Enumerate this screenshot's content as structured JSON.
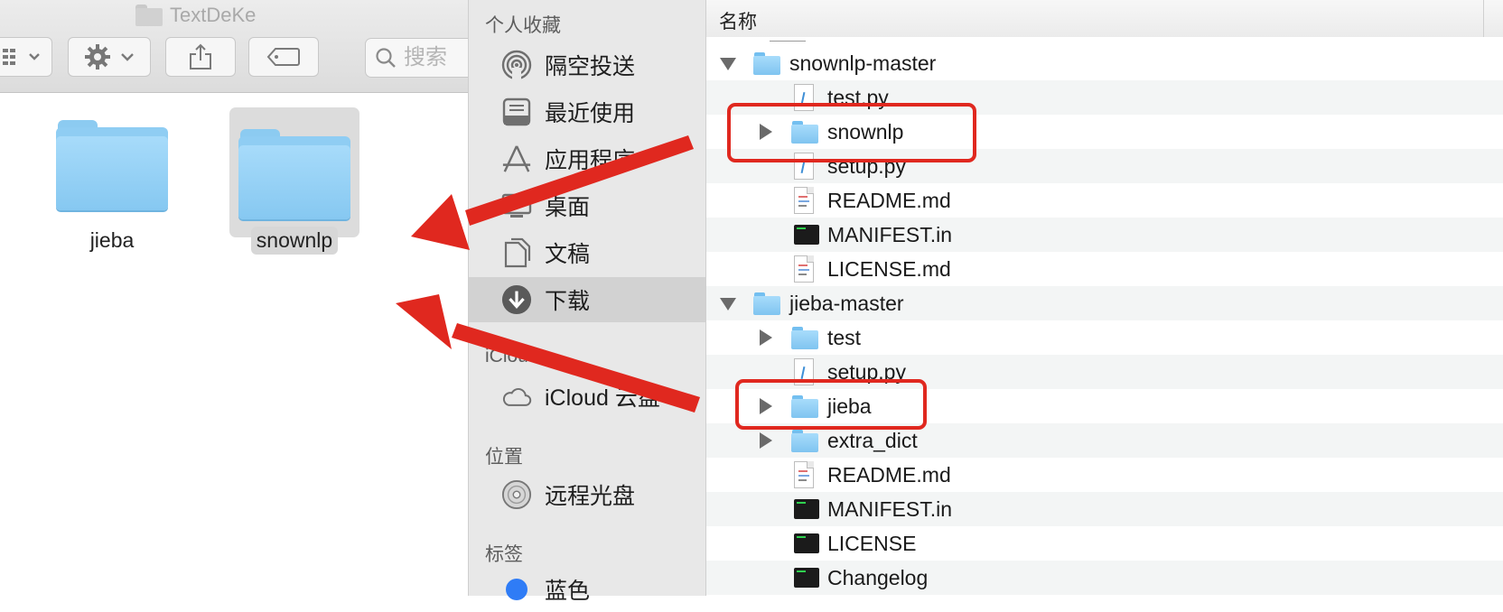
{
  "window": {
    "title": "TextDeKe"
  },
  "toolbar": {
    "search_placeholder": "搜索",
    "view_icon": "grid-view-icon",
    "gear_icon": "gear-icon",
    "share_icon": "share-icon",
    "tag_icon": "tag-icon"
  },
  "icon_view": {
    "items": [
      {
        "label": "jieba",
        "icon": "folder-icon"
      },
      {
        "label": "snownlp",
        "icon": "folder-icon",
        "selected": true
      }
    ]
  },
  "sidebar": {
    "favorites_header": "个人收藏",
    "favorites": [
      {
        "label": "隔空投送",
        "icon": "airdrop-icon"
      },
      {
        "label": "最近使用",
        "icon": "recents-icon"
      },
      {
        "label": "应用程序",
        "icon": "applications-icon"
      },
      {
        "label": "桌面",
        "icon": "desktop-icon"
      },
      {
        "label": "文稿",
        "icon": "documents-icon"
      },
      {
        "label": "下载",
        "icon": "downloads-icon",
        "selected": true
      }
    ],
    "icloud_header": "iCloud",
    "icloud": [
      {
        "label": "iCloud 云盘",
        "icon": "icloud-icon"
      }
    ],
    "locations_header": "位置",
    "locations": [
      {
        "label": "远程光盘",
        "icon": "remote-disc-icon"
      }
    ],
    "tags_header": "标签",
    "tags": [
      {
        "label": "蓝色",
        "color": "#2f7cf6"
      }
    ]
  },
  "list_view": {
    "column_name": "名称",
    "rows": [
      {
        "name": "snownlp-master",
        "kind": "folder",
        "level": 0,
        "expanded": true
      },
      {
        "name": "test.py",
        "kind": "python",
        "level": 1
      },
      {
        "name": "snownlp",
        "kind": "folder",
        "level": 1,
        "expanded": false,
        "highlighted": true
      },
      {
        "name": "setup.py",
        "kind": "python",
        "level": 1
      },
      {
        "name": "README.md",
        "kind": "document",
        "level": 1
      },
      {
        "name": "MANIFEST.in",
        "kind": "executable",
        "level": 1
      },
      {
        "name": "LICENSE.md",
        "kind": "document",
        "level": 1
      },
      {
        "name": "jieba-master",
        "kind": "folder",
        "level": 0,
        "expanded": true
      },
      {
        "name": "test",
        "kind": "folder",
        "level": 1,
        "expanded": false
      },
      {
        "name": "setup.py",
        "kind": "python",
        "level": 1
      },
      {
        "name": "jieba",
        "kind": "folder",
        "level": 1,
        "expanded": false,
        "highlighted": true
      },
      {
        "name": "extra_dict",
        "kind": "folder",
        "level": 1,
        "expanded": false
      },
      {
        "name": "README.md",
        "kind": "document",
        "level": 1
      },
      {
        "name": "MANIFEST.in",
        "kind": "executable",
        "level": 1
      },
      {
        "name": "LICENSE",
        "kind": "executable",
        "level": 1
      },
      {
        "name": "Changelog",
        "kind": "executable",
        "level": 1
      }
    ]
  },
  "annotation_color": "#e0281f"
}
